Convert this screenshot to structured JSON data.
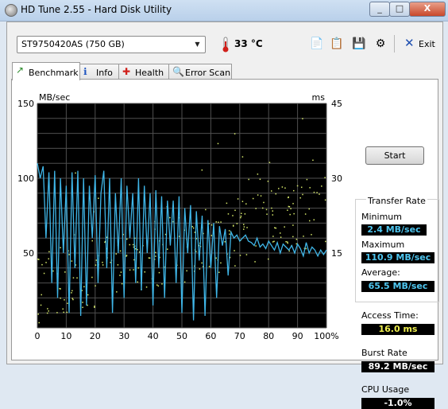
{
  "window": {
    "title": "HD Tune 2.55 - Hard Disk Utility",
    "min_label": "_",
    "max_label": "□",
    "close_label": "X"
  },
  "toolbar": {
    "drive": "ST9750420AS (750 GB)",
    "temperature": "33 °C",
    "exit_label": "Exit",
    "icons": [
      "copy-icon",
      "copy-all-icon",
      "save-icon",
      "options-icon",
      "exit-icon"
    ]
  },
  "tabs": [
    {
      "label": "Benchmark",
      "icon": "benchmark-icon",
      "active": true
    },
    {
      "label": "Info",
      "icon": "info-icon",
      "active": false
    },
    {
      "label": "Health",
      "icon": "health-icon",
      "active": false
    },
    {
      "label": "Error Scan",
      "icon": "error-scan-icon",
      "active": false
    }
  ],
  "benchmark": {
    "start_label": "Start",
    "transfer_rate_title": "Transfer Rate",
    "minimum_label": "Minimum",
    "minimum_value": "2.4 MB/sec",
    "maximum_label": "Maximum",
    "maximum_value": "110.9 MB/sec",
    "average_label": "Average:",
    "average_value": "65.5 MB/sec",
    "access_time_label": "Access Time:",
    "access_time_value": "16.0 ms",
    "burst_rate_label": "Burst Rate",
    "burst_rate_value": "89.2 MB/sec",
    "cpu_usage_label": "CPU Usage",
    "cpu_usage_value": "-1.0%"
  },
  "chart_data": {
    "type": "line",
    "left_axis_unit": "MB/sec",
    "right_axis_unit": "ms",
    "left_ticks": [
      "150",
      "100",
      "50"
    ],
    "right_ticks": [
      "45",
      "30",
      "15"
    ],
    "x_ticks": [
      "0",
      "10",
      "20",
      "30",
      "40",
      "50",
      "60",
      "70",
      "80",
      "90",
      "100%"
    ],
    "xlim": [
      0,
      100
    ],
    "ylim_left": [
      0,
      150
    ],
    "ylim_right": [
      0,
      45
    ],
    "background": "#000000",
    "grid_color": "#4f4f4f",
    "series": [
      {
        "color": "#3fb6e8",
        "x": [
          0,
          1,
          2,
          3,
          4,
          5,
          6,
          7,
          8,
          9,
          10,
          11,
          12,
          13,
          14,
          15,
          16,
          17,
          18,
          19,
          20,
          21,
          22,
          23,
          24,
          25,
          26,
          27,
          28,
          29,
          30,
          31,
          32,
          33,
          34,
          35,
          36,
          37,
          38,
          39,
          40,
          41,
          42,
          43,
          44,
          45,
          46,
          47,
          48,
          49,
          50,
          51,
          52,
          53,
          54,
          55,
          56,
          57,
          58,
          59,
          60,
          61,
          62,
          63,
          64,
          65,
          66,
          67,
          68,
          69,
          70,
          71,
          72,
          73,
          74,
          75,
          76,
          77,
          78,
          79,
          80,
          81,
          82,
          83,
          84,
          85,
          86,
          87,
          88,
          89,
          90,
          91,
          92,
          93,
          94,
          95,
          96,
          97,
          98,
          99,
          100
        ],
        "values": [
          110,
          100,
          108,
          60,
          104,
          30,
          105,
          20,
          100,
          50,
          95,
          10,
          104,
          40,
          105,
          8,
          100,
          15,
          95,
          60,
          102,
          30,
          90,
          105,
          40,
          100,
          10,
          90,
          50,
          100,
          20,
          95,
          60,
          90,
          30,
          100,
          25,
          95,
          50,
          90,
          15,
          92,
          40,
          88,
          20,
          85,
          55,
          85,
          30,
          88,
          10,
          80,
          50,
          82,
          5,
          78,
          45,
          75,
          8,
          72,
          40,
          70,
          20,
          68,
          55,
          66,
          35,
          64,
          60,
          62,
          58,
          60,
          62,
          58,
          57,
          55,
          60,
          54,
          56,
          53,
          58,
          55,
          52,
          57,
          50,
          56,
          54,
          52,
          55,
          50,
          56,
          53,
          48,
          57,
          50,
          54,
          52,
          48,
          52,
          49,
          52
        ]
      }
    ],
    "scatter_series": {
      "color": "#d6e86a",
      "axis": "right"
    }
  }
}
